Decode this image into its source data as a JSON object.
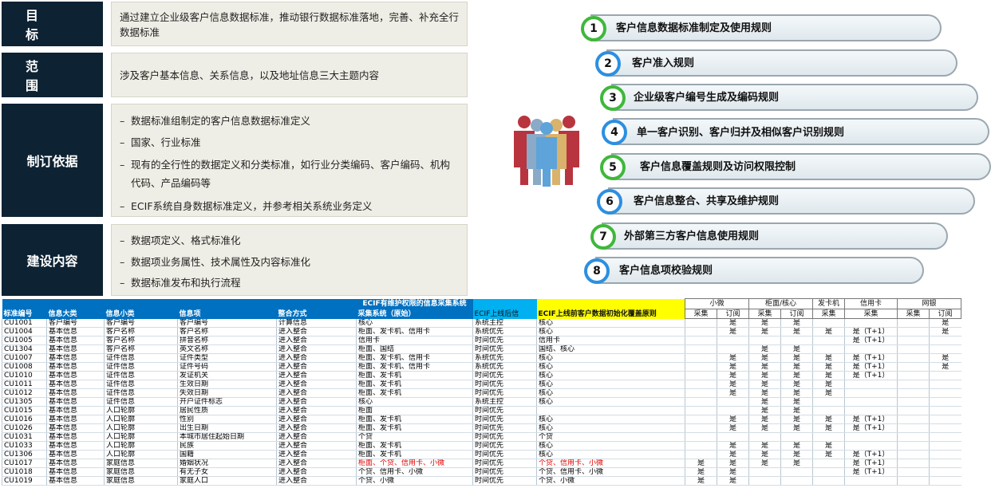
{
  "left": [
    {
      "label": "目  标",
      "text": "通过建立企业级客户信息数据标准，推动银行数据标准落地，完善、补充全行数据标准"
    },
    {
      "label": "范  围",
      "text": "涉及客户基本信息、关系信息，以及地址信息三大主题内容"
    },
    {
      "label": "制订依据",
      "items": [
        "数据标准组制定的客户信息数据标准定义",
        "国家、行业标准",
        "现有的全行性的数据定义和分类标准，如行业分类编码、客户编码、机构代码、产品编码等",
        "ECIF系统自身数据标准定义，并参考相关系统业务定义"
      ]
    },
    {
      "label": "建设内容",
      "items": [
        "数据项定义、格式标准化",
        "数据项业务属性、技术属性及内容标准化",
        "数据标准发布和执行流程"
      ]
    }
  ],
  "rules": [
    {
      "n": "1",
      "text": "客户信息数据标准制定及使用规则"
    },
    {
      "n": "2",
      "text": "客户准入规则"
    },
    {
      "n": "3",
      "text": "企业级客户编号生成及编码规则"
    },
    {
      "n": "4",
      "text": "单一客户识别、客户归并及相似客户识别规则"
    },
    {
      "n": "5",
      "text": "客户信息覆盖规则及访问权限控制"
    },
    {
      "n": "6",
      "text": "客户信息整合、共享及维护规则"
    },
    {
      "n": "7",
      "text": "外部第三方客户信息使用规则"
    },
    {
      "n": "8",
      "text": "客户信息项校验规则"
    }
  ],
  "colors": {
    "dark": "#0d2233",
    "green": "#3fb83a",
    "blue": "#2c8fe0"
  },
  "icons": [
    "people-group-icon"
  ],
  "table": {
    "topHeader": {
      "ecifSys": "ECIF有维护权限的信息采集系统",
      "xiaowei": "小微",
      "guimian": "柜面/核心",
      "fakaji": "发卡机",
      "xinyongka": "信用卡",
      "wangyin": "网银"
    },
    "headers": [
      "标准编号",
      "信息大类",
      "信息小类",
      "信息项",
      "整合方式",
      "采集系统（原始）",
      "ECIF上线后信",
      "ECIF上线前客户数据初始化覆盖原则",
      "采集",
      "订阅",
      "采集",
      "订阅",
      "采集",
      "采集",
      "采集",
      "订阅"
    ],
    "rows": [
      [
        "CU1001",
        "客户编号",
        "客户编号",
        "客户编号",
        "计算信息",
        "核心",
        "系统主控",
        "核心",
        "",
        "是",
        "是",
        "是",
        "",
        "",
        "",
        "是"
      ],
      [
        "CU1004",
        "基本信息",
        "客户名称",
        "客户名称",
        "进入整合",
        "柜面、发卡机、信用卡",
        "系统优先",
        "核心",
        "",
        "是",
        "是",
        "是",
        "是",
        "是（T+1）",
        "",
        "是"
      ],
      [
        "CU1005",
        "基本信息",
        "客户名称",
        "拼音名称",
        "进入整合",
        "信用卡",
        "时间优先",
        "信用卡",
        "",
        "",
        "",
        "",
        "",
        "是（T+1）",
        "",
        ""
      ],
      [
        "CU1304",
        "基本信息",
        "客户名称",
        "英文名称",
        "进入整合",
        "柜面、国结",
        "时间优先",
        "国结、核心",
        "",
        "",
        "是",
        "是",
        "",
        "",
        "",
        ""
      ],
      [
        "CU1007",
        "基本信息",
        "证件信息",
        "证件类型",
        "进入整合",
        "柜面、发卡机、信用卡",
        "系统优先",
        "核心",
        "",
        "是",
        "是",
        "是",
        "是",
        "是（T+1）",
        "",
        "是"
      ],
      [
        "CU1008",
        "基本信息",
        "证件信息",
        "证件号码",
        "进入整合",
        "柜面、发卡机、信用卡",
        "系统优先",
        "核心",
        "",
        "是",
        "是",
        "是",
        "是",
        "是（T+1）",
        "",
        "是"
      ],
      [
        "CU1010",
        "基本信息",
        "证件信息",
        "发证机关",
        "进入整合",
        "柜面、发卡机",
        "时间优先",
        "核心",
        "",
        "是",
        "是",
        "是",
        "是",
        "是（T+1）",
        "",
        ""
      ],
      [
        "CU1011",
        "基本信息",
        "证件信息",
        "生效日期",
        "进入整合",
        "柜面、发卡机",
        "时间优先",
        "核心",
        "",
        "是",
        "是",
        "是",
        "是",
        "",
        "",
        ""
      ],
      [
        "CU1012",
        "基本信息",
        "证件信息",
        "失效日期",
        "进入整合",
        "柜面、发卡机",
        "时间优先",
        "核心",
        "",
        "是",
        "是",
        "是",
        "是",
        "",
        "",
        ""
      ],
      [
        "CU1305",
        "基本信息",
        "证件信息",
        "开户证件标志",
        "进入整合",
        "核心",
        "系统主控",
        "核心",
        "",
        "",
        "是",
        "是",
        "",
        "",
        "",
        ""
      ],
      [
        "CU1015",
        "基本信息",
        "人口轮廓",
        "居民性质",
        "进入整合",
        "柜面",
        "时间优先",
        "",
        "",
        "",
        "是",
        "是",
        "",
        "",
        "",
        ""
      ],
      [
        "CU1016",
        "基本信息",
        "人口轮廓",
        "性别",
        "进入整合",
        "柜面、发卡机",
        "时间优先",
        "核心",
        "",
        "是",
        "是",
        "是",
        "是",
        "是（T+1）",
        "",
        ""
      ],
      [
        "CU1026",
        "基本信息",
        "人口轮廓",
        "出生日期",
        "进入整合",
        "柜面、发卡机",
        "时间优先",
        "核心",
        "",
        "是",
        "是",
        "是",
        "是",
        "是（T+1）",
        "",
        ""
      ],
      [
        "CU1031",
        "基本信息",
        "人口轮廓",
        "本城市居住起始日期",
        "进入整合",
        "个贷",
        "时间优先",
        "个贷",
        "",
        "",
        "",
        "",
        "",
        "",
        "",
        ""
      ],
      [
        "CU1033",
        "基本信息",
        "人口轮廓",
        "民族",
        "进入整合",
        "柜面、发卡机",
        "时间优先",
        "核心",
        "",
        "是",
        "是",
        "是",
        "是",
        "",
        "",
        ""
      ],
      [
        "CU1306",
        "基本信息",
        "人口轮廓",
        "国籍",
        "进入整合",
        "柜面、发卡机",
        "时间优先",
        "核心",
        "",
        "是",
        "是",
        "是",
        "是",
        "是（T+1）",
        "",
        ""
      ],
      [
        "CU1017",
        "基本信息",
        "家庭信息",
        "婚姻状况",
        "进入整合",
        "柜面、个贷、信用卡、小微",
        "时间优先",
        "个贷、信用卡、小微",
        "是",
        "是",
        "是",
        "是",
        "",
        "是（T+1）",
        "",
        ""
      ],
      [
        "CU1018",
        "基本信息",
        "家庭信息",
        "有无子女",
        "进入整合",
        "个贷、信用卡、小微",
        "时间优先",
        "个贷、信用卡、小微",
        "是",
        "是",
        "",
        "",
        "",
        "是（T+1）",
        "",
        ""
      ],
      [
        "CU1019",
        "基本信息",
        "家庭信息",
        "家庭人口",
        "进入整合",
        "个贷、小微",
        "时间优先",
        "个贷、小微",
        "是",
        "是",
        "",
        "",
        "",
        "",
        "",
        ""
      ]
    ]
  }
}
